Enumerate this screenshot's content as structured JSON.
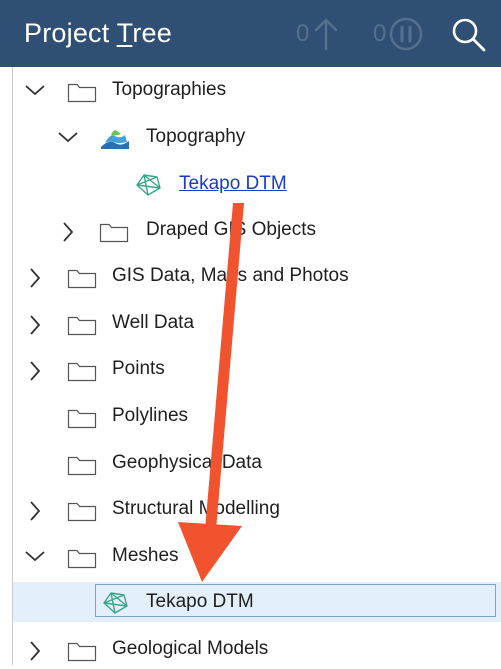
{
  "header": {
    "title_pre": "Project ",
    "title_accel": "T",
    "title_post": "ree",
    "upload_count": "0",
    "pause_count": "0",
    "icons": {
      "upload": "arrow-up-icon",
      "pause": "pause-circle-icon",
      "search": "search-icon"
    }
  },
  "tree": {
    "items": [
      {
        "label": "Topographies",
        "expander": "expanded",
        "icon": "folder-icon"
      },
      {
        "label": "Topography",
        "expander": "expanded",
        "icon": "topography-icon"
      },
      {
        "label": "Tekapo DTM",
        "expander": "none",
        "icon": "mesh-icon",
        "link": true
      },
      {
        "label": "Draped GIS Objects",
        "expander": "collapsed",
        "icon": "folder-icon"
      },
      {
        "label": "GIS Data, Maps and Photos",
        "expander": "collapsed",
        "icon": "folder-icon"
      },
      {
        "label": "Well Data",
        "expander": "collapsed",
        "icon": "folder-icon"
      },
      {
        "label": "Points",
        "expander": "collapsed",
        "icon": "folder-icon"
      },
      {
        "label": "Polylines",
        "expander": "none",
        "icon": "folder-icon"
      },
      {
        "label": "Geophysical Data",
        "expander": "none",
        "icon": "folder-icon"
      },
      {
        "label": "Structural Modelling",
        "expander": "collapsed",
        "icon": "folder-icon"
      },
      {
        "label": "Meshes",
        "expander": "expanded",
        "icon": "folder-icon"
      },
      {
        "label": "Tekapo DTM",
        "expander": "none",
        "icon": "mesh-icon",
        "selected": true
      },
      {
        "label": "Geological Models",
        "expander": "collapsed",
        "icon": "folder-icon"
      }
    ]
  },
  "colors": {
    "header_bg": "#2f4f74",
    "selection_bg": "#e3f0fb",
    "arrow": "#f0532e",
    "link": "#1a3cc9",
    "mesh_icon": "#3aa58a"
  }
}
